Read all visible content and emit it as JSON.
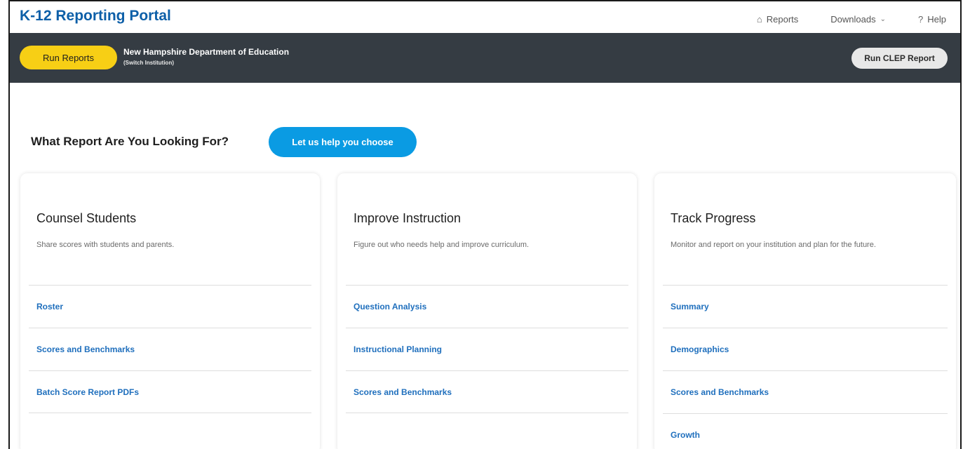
{
  "header": {
    "brand": "K-12 Reporting Portal",
    "nav": [
      {
        "label": "Reports",
        "icon": "home-icon"
      },
      {
        "label": "Downloads",
        "icon": "chevron-down-icon"
      },
      {
        "label": "Help",
        "icon": "question-icon"
      }
    ]
  },
  "toolbar": {
    "run_reports_label": "Run Reports",
    "institution_name": "New Hampshire Department of Education",
    "switch_label": "(Switch Institution)",
    "run_clep_label": "Run CLEP Report"
  },
  "main": {
    "question": "What Report Are You Looking For?",
    "help_button_label": "Let us help you choose",
    "cards": [
      {
        "title": "Counsel Students",
        "description": "Share scores with students and parents.",
        "links": [
          "Roster",
          "Scores and Benchmarks",
          "Batch Score Report PDFs"
        ]
      },
      {
        "title": "Improve Instruction",
        "description": "Figure out who needs help and improve curriculum.",
        "links": [
          "Question Analysis",
          "Instructional Planning",
          "Scores and Benchmarks"
        ]
      },
      {
        "title": "Track Progress",
        "description": "Monitor and report on your institution and plan for the future.",
        "links": [
          "Summary",
          "Demographics",
          "Scores and Benchmarks",
          "Growth"
        ]
      }
    ]
  },
  "colors": {
    "brand_blue": "#0d5fa8",
    "dark_bar": "#353c43",
    "run_reports_yellow": "#f7cf15",
    "help_button_blue": "#0a9be3",
    "link_blue": "#1f6fbd"
  }
}
